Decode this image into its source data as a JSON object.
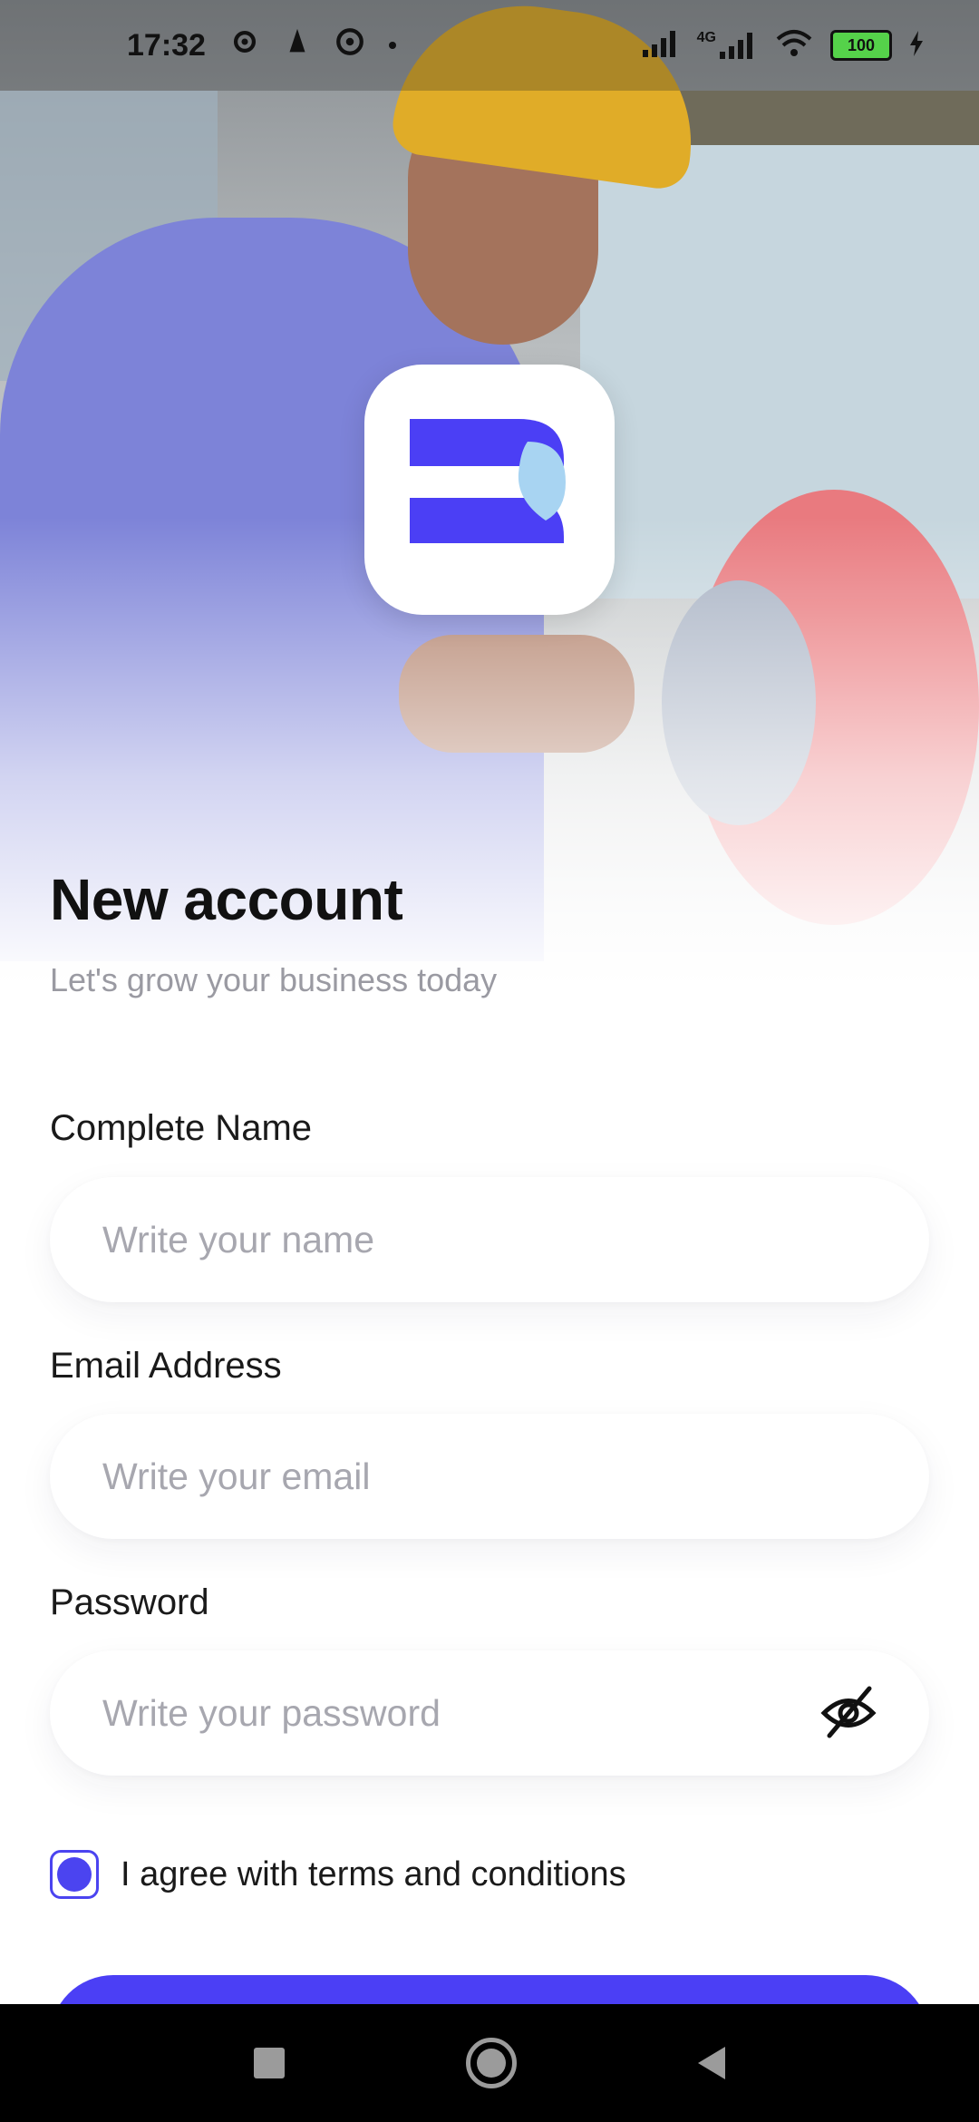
{
  "status_bar": {
    "time": "17:32",
    "network": "4G",
    "battery": "100"
  },
  "icons": {
    "settings": "gear-icon",
    "notification": "notification-icon",
    "at": "at-icon",
    "signal": "signal-icon",
    "wifi": "wifi-icon",
    "battery": "battery-icon",
    "logo": "app-logo",
    "visibility": "eye-off-icon"
  },
  "header": {
    "title": "New account",
    "subtitle": "Let's grow your business today"
  },
  "form": {
    "name_label": "Complete Name",
    "name_placeholder": "Write your name",
    "email_label": "Email Address",
    "email_placeholder": "Write your email",
    "password_label": "Password",
    "password_placeholder": "Write your password",
    "terms_label": "I agree with terms and conditions",
    "terms_checked": true
  },
  "colors": {
    "accent": "#4b3ff5",
    "logo_light": "#a8d4f2",
    "text_muted": "#9a9aa2"
  }
}
